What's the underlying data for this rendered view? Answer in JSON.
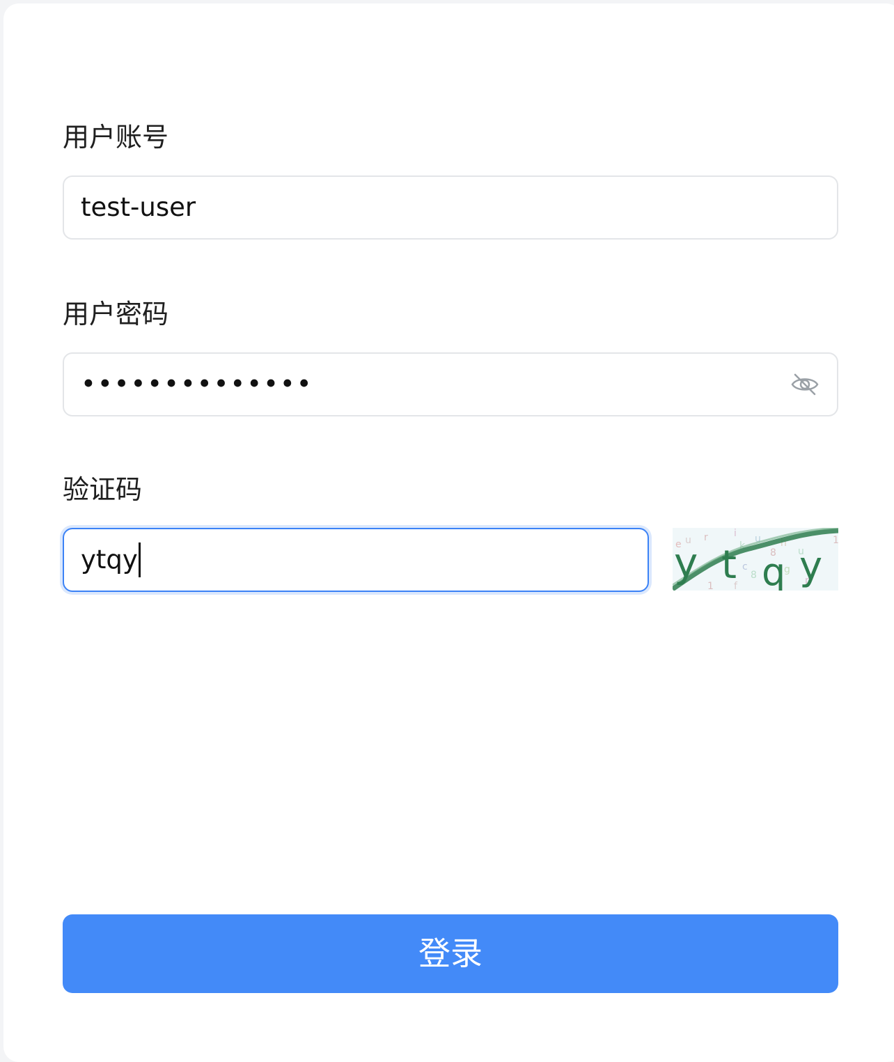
{
  "form": {
    "username": {
      "label": "用户账号",
      "value": "test-user"
    },
    "password": {
      "label": "用户密码",
      "masked_value": "••••••••••••••",
      "toggle_icon": "eye-off-icon"
    },
    "captcha": {
      "label": "验证码",
      "value": "ytqy",
      "image_text": "ytqy"
    },
    "submit_label": "登录"
  },
  "colors": {
    "primary": "#438af8",
    "focus_border": "#3b82f6",
    "captcha_glyph": "#2e7d4f"
  }
}
